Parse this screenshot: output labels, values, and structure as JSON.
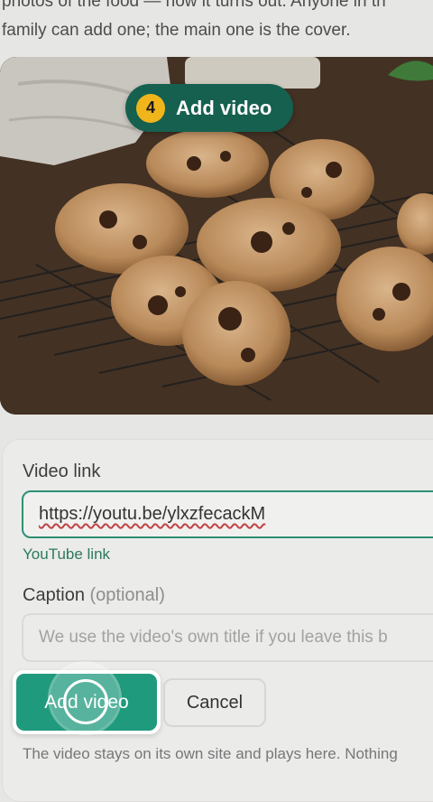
{
  "intro_text": "Photos of the food — how it turns out. Anyone in the\nfamily can add one; the main one is the cover.",
  "intro_line1": "photos of the food — how it turns out. Anyone in th",
  "intro_line2": "family can add one; the main one is the cover.",
  "step": {
    "number": "4",
    "label": "Add video"
  },
  "form": {
    "video_link_label": "Video link",
    "video_link_value": "https://youtu.be/ylxzfecackM",
    "video_link_help": "YouTube link",
    "caption_label": "Caption",
    "caption_optional": "(optional)",
    "caption_placeholder": "We use the video's own title if you leave this b",
    "add_button": "Add video",
    "cancel_button": "Cancel",
    "footnote": "The video stays on its own site and plays here. Nothing"
  },
  "colors": {
    "accent": "#1f9a7d",
    "pill": "#16604f",
    "step_badge": "#f1b51c",
    "help_text": "#2c7a5d"
  },
  "photo": {
    "subject": "chocolate chip cookies on cooling rack"
  }
}
